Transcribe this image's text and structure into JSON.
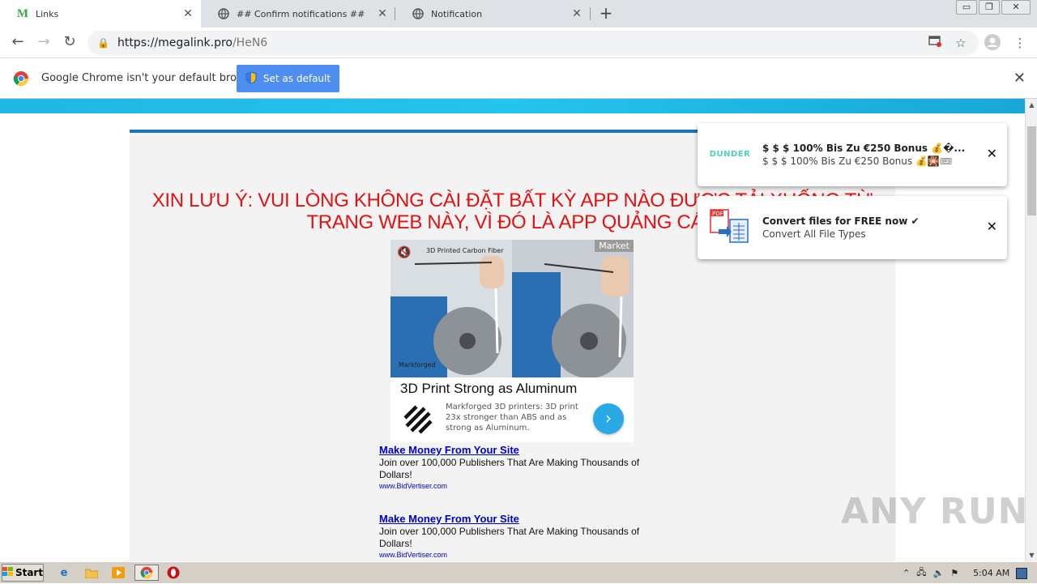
{
  "tabs": [
    {
      "title": "Links",
      "active": true,
      "icon": "m-favicon"
    },
    {
      "title": "## Confirm notifications ##",
      "active": false,
      "icon": "globe-icon"
    },
    {
      "title": "Notification",
      "active": false,
      "icon": "globe-icon"
    }
  ],
  "window_controls": {
    "minimize": "▭",
    "restore": "❐",
    "close": "✕"
  },
  "omnibox": {
    "scheme_host": "https://megalink.pro",
    "path": "/HeN6"
  },
  "infobar": {
    "message": "Google Chrome isn't your default browser",
    "button": "Set as default"
  },
  "page": {
    "warning": "XIN LƯU Ý: VUI LÒNG KHÔNG CÀI ĐẶT BẤT KỲ APP NÀO ĐƯỢC TẢI XUỐNG TỪ TRANG WEB NÀY, VÌ ĐÓ LÀ APP QUẢNG CÁO",
    "ad": {
      "market_label": "Market",
      "video_caption": "3D Printed Carbon Fiber",
      "brand_watermark": "Markforged",
      "headline": "3D Print Strong as Aluminum",
      "description": "Markforged 3D printers: 3D print 23x stronger than ABS and as strong as Aluminum."
    },
    "text_ads": [
      {
        "title": "Make Money From Your Site",
        "desc": "Join over 100,000 Publishers That Are Making Thousands of Dollars!",
        "url": "www.BidVertiser.com"
      },
      {
        "title": "Make Money From Your Site",
        "desc": "Join over 100,000 Publishers That Are Making Thousands of Dollars!",
        "url": "www.BidVertiser.com"
      }
    ]
  },
  "notifications": [
    {
      "icon_text": "DUNDER",
      "title": "$ $ $  100% Bis Zu €250 Bonus 💰�...",
      "body": "$ $ $  100% Bis Zu €250 Bonus 💰🎇🎟"
    },
    {
      "icon_text": "PDF",
      "title": "Convert files for FREE now ✔",
      "body": "Convert All File Types"
    }
  ],
  "watermark": "ANY RUN",
  "taskbar": {
    "start": "Start",
    "clock": "5:04 AM"
  },
  "colors": {
    "warning_red": "#e31212",
    "banner_blue": "#23c4ee",
    "accent_button": "#4d8ef0"
  }
}
